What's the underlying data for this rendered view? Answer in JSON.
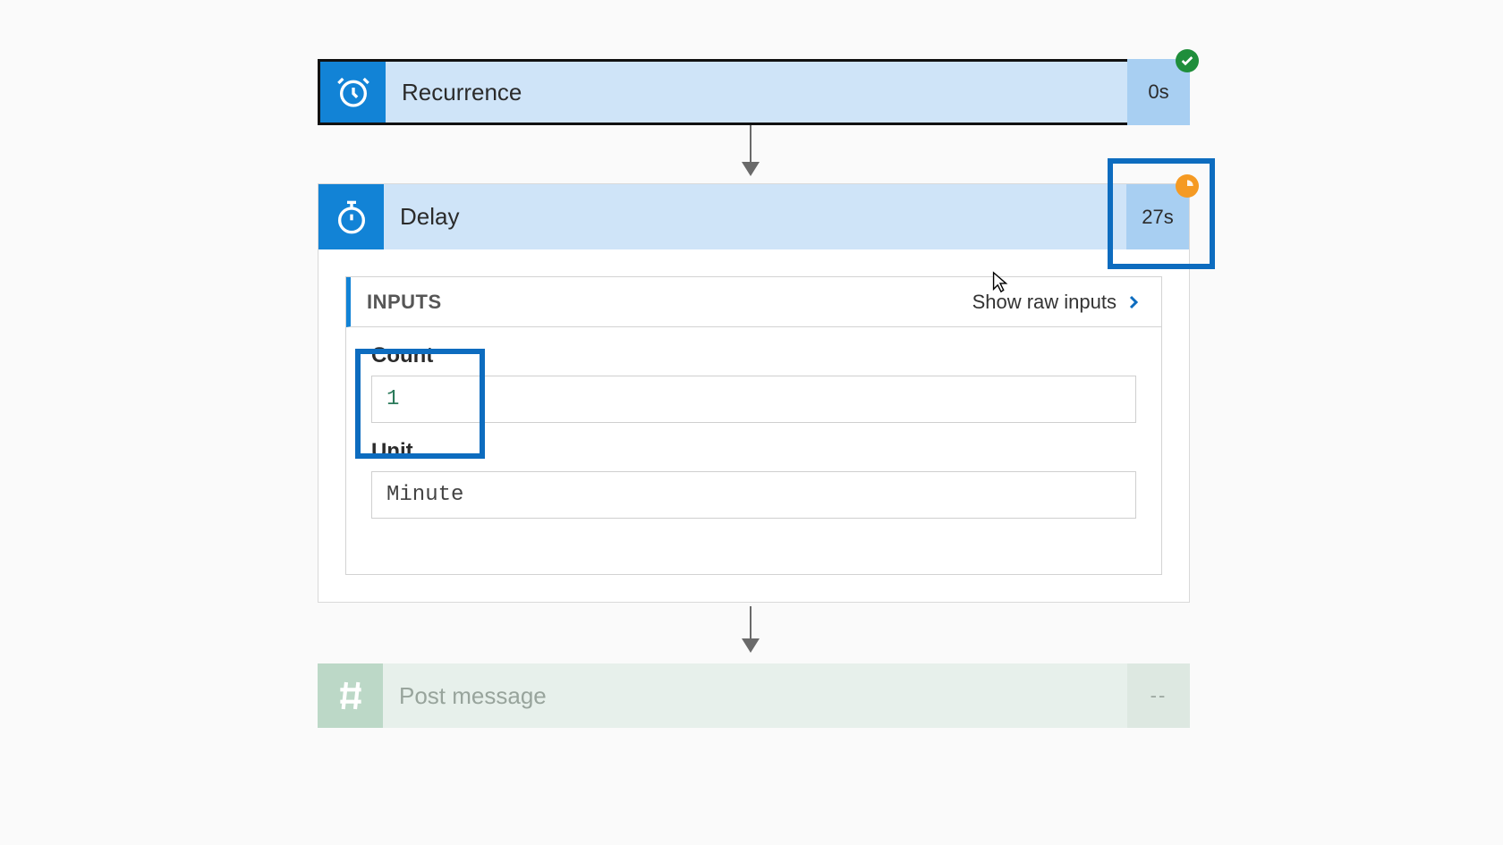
{
  "steps": {
    "recurrence": {
      "title": "Recurrence",
      "duration": "0s",
      "status": "success"
    },
    "delay": {
      "title": "Delay",
      "duration": "27s",
      "status": "running"
    },
    "post": {
      "title": "Post message",
      "duration": "--",
      "status": "pending"
    }
  },
  "delay_panel": {
    "header": "INPUTS",
    "show_raw_label": "Show raw inputs",
    "fields": {
      "count": {
        "label": "Count",
        "value": "1"
      },
      "unit": {
        "label": "Unit",
        "value": "Minute"
      }
    }
  }
}
